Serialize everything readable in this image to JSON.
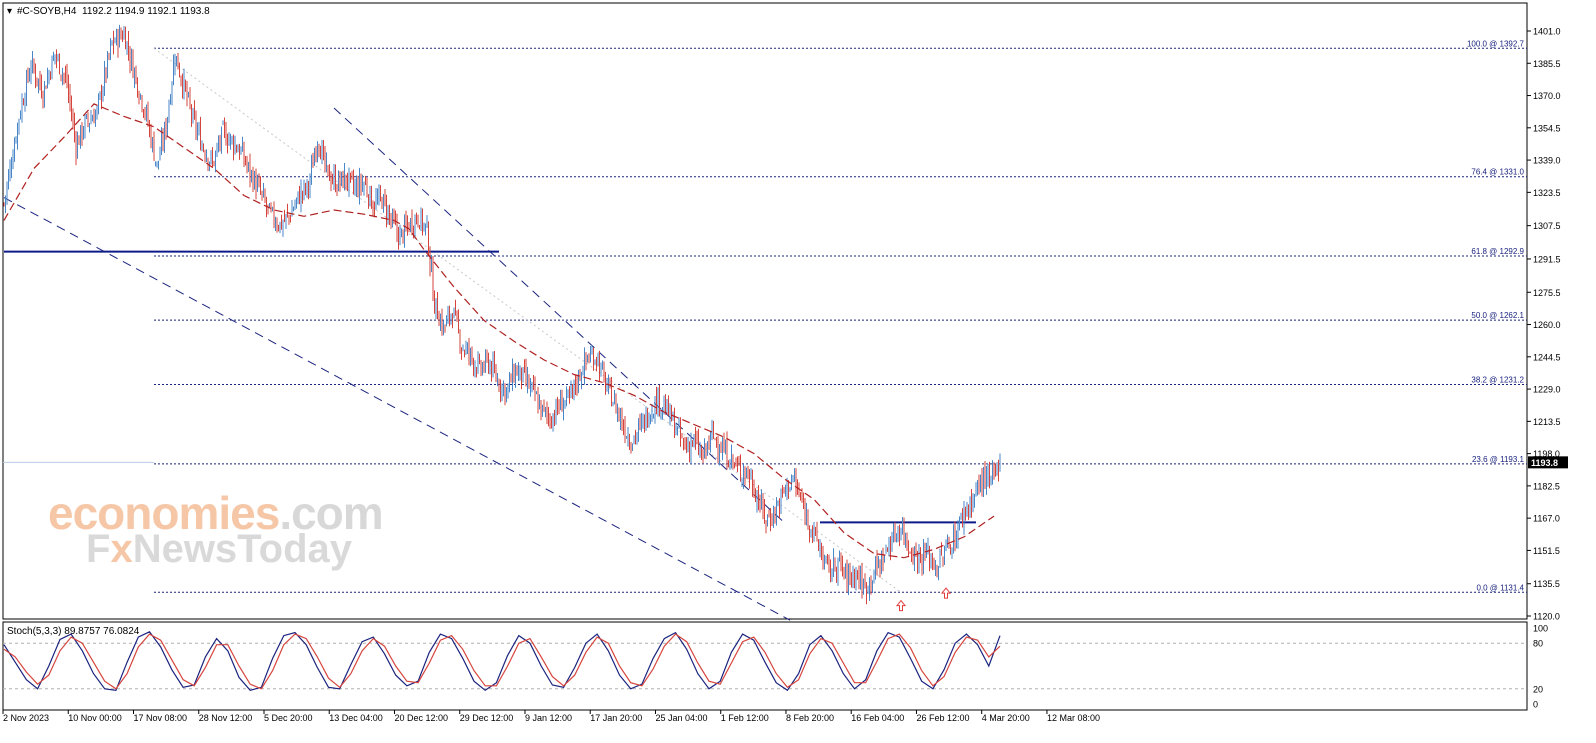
{
  "header": {
    "symbol": "#C-SOYB,H4",
    "ohlc": "1192.2 1194.9 1192.1 1193.8"
  },
  "current_price_label": "1193.8",
  "watermark": {
    "line1_part1": "economies",
    "line1_part2": ".com",
    "line2_part1": "F",
    "line2_x": "x",
    "line2_part2": "NewsToday"
  },
  "colors": {
    "bull_candle": "#4a87c8",
    "bear_candle": "#d6453d",
    "moving_average": "#b02020",
    "fib_lines": "#1a237e",
    "channel_lines": "#1a237e",
    "support_line": "#0d1b8a",
    "stoch_main": "#1a237e",
    "stoch_signal": "#d6453d",
    "arrows": "#e23b3b"
  },
  "chart_data": [
    {
      "type": "candlestick",
      "symbol": "#C-SOYB",
      "timeframe": "H4",
      "ylim": [
        1120.0,
        1408.0
      ],
      "y_tick_labels": [
        "1401.0",
        "1385.5",
        "1370.0",
        "1354.5",
        "1339.0",
        "1323.5",
        "1307.5",
        "1291.5",
        "1275.5",
        "1260.0",
        "1244.5",
        "1229.0",
        "1213.5",
        "1198.0",
        "1182.5",
        "1167.0",
        "1151.5",
        "1135.5",
        "1120.0"
      ],
      "x_tick_labels": [
        "2 Nov 2023",
        "10 Nov 00:00",
        "17 Nov 08:00",
        "28 Nov 12:00",
        "5 Dec 20:00",
        "13 Dec 04:00",
        "20 Dec 12:00",
        "29 Dec 12:00",
        "9 Jan 12:00",
        "17 Jan 20:00",
        "25 Jan 04:00",
        "1 Feb 12:00",
        "8 Feb 20:00",
        "16 Feb 04:00",
        "26 Feb 12:00",
        "4 Mar 20:00",
        "12 Mar 08:00"
      ],
      "close_path": [
        [
          0,
          1318
        ],
        [
          10,
          1360
        ],
        [
          18,
          1385
        ],
        [
          26,
          1372
        ],
        [
          34,
          1390
        ],
        [
          42,
          1376
        ],
        [
          48,
          1346
        ],
        [
          54,
          1356
        ],
        [
          62,
          1362
        ],
        [
          72,
          1395
        ],
        [
          80,
          1400
        ],
        [
          88,
          1378
        ],
        [
          95,
          1360
        ],
        [
          102,
          1336
        ],
        [
          108,
          1355
        ],
        [
          114,
          1390
        ],
        [
          120,
          1374
        ],
        [
          126,
          1358
        ],
        [
          133,
          1345
        ],
        [
          139,
          1337
        ],
        [
          146,
          1352
        ],
        [
          152,
          1348
        ],
        [
          158,
          1343
        ],
        [
          164,
          1333
        ],
        [
          171,
          1323
        ],
        [
          177,
          1313
        ],
        [
          184,
          1308
        ],
        [
          190,
          1312
        ],
        [
          197,
          1322
        ],
        [
          203,
          1326
        ],
        [
          209,
          1350
        ],
        [
          215,
          1333
        ],
        [
          222,
          1328
        ],
        [
          228,
          1330
        ],
        [
          234,
          1325
        ],
        [
          240,
          1328
        ],
        [
          246,
          1318
        ],
        [
          252,
          1320
        ],
        [
          258,
          1310
        ],
        [
          264,
          1302
        ],
        [
          270,
          1308
        ],
        [
          276,
          1312
        ],
        [
          282,
          1305
        ],
        [
          287,
          1270
        ],
        [
          293,
          1258
        ],
        [
          299,
          1267
        ],
        [
          305,
          1250
        ],
        [
          311,
          1245
        ],
        [
          317,
          1238
        ],
        [
          323,
          1242
        ],
        [
          329,
          1233
        ],
        [
          335,
          1228
        ],
        [
          341,
          1238
        ],
        [
          347,
          1234
        ],
        [
          353,
          1227
        ],
        [
          359,
          1218
        ],
        [
          365,
          1215
        ],
        [
          371,
          1222
        ],
        [
          377,
          1224
        ],
        [
          383,
          1235
        ],
        [
          389,
          1244
        ],
        [
          395,
          1245
        ],
        [
          400,
          1233
        ],
        [
          406,
          1224
        ],
        [
          412,
          1213
        ],
        [
          418,
          1204
        ],
        [
          424,
          1210
        ],
        [
          430,
          1218
        ],
        [
          436,
          1224
        ],
        [
          442,
          1219
        ],
        [
          448,
          1210
        ],
        [
          454,
          1201
        ],
        [
          460,
          1204
        ],
        [
          466,
          1196
        ],
        [
          472,
          1207
        ],
        [
          478,
          1201
        ],
        [
          484,
          1196
        ],
        [
          490,
          1190
        ],
        [
          496,
          1189
        ],
        [
          502,
          1178
        ],
        [
          508,
          1166
        ],
        [
          514,
          1170
        ],
        [
          520,
          1180
        ],
        [
          526,
          1186
        ],
        [
          532,
          1174
        ],
        [
          538,
          1163
        ],
        [
          544,
          1152
        ],
        [
          550,
          1141
        ],
        [
          556,
          1146
        ],
        [
          562,
          1138
        ],
        [
          568,
          1141
        ],
        [
          574,
          1133
        ],
        [
          580,
          1141
        ],
        [
          586,
          1148
        ],
        [
          592,
          1157
        ],
        [
          598,
          1163
        ],
        [
          604,
          1152
        ],
        [
          610,
          1148
        ],
        [
          616,
          1150
        ],
        [
          622,
          1143
        ],
        [
          628,
          1152
        ],
        [
          634,
          1158
        ],
        [
          640,
          1170
        ],
        [
          646,
          1176
        ],
        [
          652,
          1186
        ],
        [
          658,
          1184
        ],
        [
          664,
          1193.8
        ]
      ],
      "moving_average": [
        [
          0,
          1310
        ],
        [
          20,
          1335
        ],
        [
          40,
          1350
        ],
        [
          60,
          1366
        ],
        [
          80,
          1360
        ],
        [
          100,
          1355
        ],
        [
          120,
          1345
        ],
        [
          140,
          1335
        ],
        [
          160,
          1322
        ],
        [
          180,
          1315
        ],
        [
          200,
          1312
        ],
        [
          220,
          1315
        ],
        [
          240,
          1313
        ],
        [
          260,
          1310
        ],
        [
          270,
          1306
        ],
        [
          280,
          1296
        ],
        [
          300,
          1278
        ],
        [
          320,
          1262
        ],
        [
          340,
          1252
        ],
        [
          360,
          1243
        ],
        [
          380,
          1236
        ],
        [
          400,
          1232
        ],
        [
          420,
          1226
        ],
        [
          440,
          1218
        ],
        [
          460,
          1212
        ],
        [
          480,
          1206
        ],
        [
          500,
          1198
        ],
        [
          520,
          1186
        ],
        [
          540,
          1176
        ],
        [
          560,
          1160
        ],
        [
          580,
          1150
        ],
        [
          600,
          1148
        ],
        [
          620,
          1152
        ],
        [
          640,
          1158
        ],
        [
          660,
          1168
        ]
      ],
      "fibonacci_levels": [
        {
          "label": "100.0 @ 1392.7",
          "value": 1392.7
        },
        {
          "label": "76.4 @ 1331.0",
          "value": 1331.0
        },
        {
          "label": "61.8 @ 1292.9",
          "value": 1292.9
        },
        {
          "label": "50.0 @ 1262.1",
          "value": 1262.1
        },
        {
          "label": "38.2 @ 1231.2",
          "value": 1231.2
        },
        {
          "label": "23.6 @ 1193.1",
          "value": 1193.1
        },
        {
          "label": "0.0 @ 1131.4",
          "value": 1131.4
        }
      ],
      "fib_start_bar": 100,
      "support_resistance": [
        {
          "from_bar": 0,
          "to_bar": 330,
          "value": 1295
        },
        {
          "from_bar": 544,
          "to_bar": 648,
          "value": 1165
        }
      ],
      "channel": {
        "upper": [
          [
            220,
            1364
          ],
          [
            520,
            1165
          ]
        ],
        "lower": [
          [
            0,
            1321
          ],
          [
            524,
            1118
          ]
        ]
      },
      "arrows": [
        {
          "bar": 598,
          "value": 1125
        },
        {
          "bar": 628,
          "value": 1131
        }
      ]
    },
    {
      "type": "line",
      "indicator": "Stoch(5,3,3)",
      "header_label": "Stoch(5,3,3) 89.8757 76.0824",
      "ylim": [
        0,
        100
      ],
      "y_tick_labels": [
        "100",
        "80",
        "20",
        "0"
      ],
      "levels": [
        80,
        20
      ],
      "series": [
        {
          "name": "main",
          "values": [
            78,
            55,
            32,
            20,
            50,
            85,
            92,
            70,
            40,
            20,
            18,
            55,
            88,
            95,
            75,
            45,
            22,
            25,
            62,
            86,
            70,
            35,
            18,
            22,
            60,
            90,
            94,
            78,
            48,
            22,
            20,
            52,
            82,
            88,
            66,
            38,
            24,
            30,
            68,
            92,
            86,
            60,
            30,
            18,
            28,
            64,
            90,
            80,
            50,
            25,
            22,
            48,
            80,
            92,
            70,
            38,
            20,
            26,
            60,
            86,
            94,
            72,
            40,
            20,
            30,
            68,
            92,
            84,
            55,
            28,
            18,
            40,
            78,
            90,
            70,
            40,
            20,
            32,
            70,
            94,
            88,
            60,
            30,
            20,
            45,
            80,
            92,
            78,
            50,
            89.9
          ]
        },
        {
          "name": "signal",
          "values": [
            72,
            62,
            42,
            26,
            38,
            70,
            88,
            80,
            55,
            30,
            20,
            40,
            75,
            92,
            84,
            58,
            32,
            24,
            48,
            78,
            78,
            50,
            26,
            20,
            44,
            78,
            92,
            86,
            62,
            34,
            22,
            40,
            70,
            86,
            76,
            50,
            30,
            28,
            54,
            84,
            90,
            72,
            44,
            24,
            24,
            50,
            80,
            86,
            62,
            36,
            24,
            38,
            68,
            88,
            80,
            50,
            28,
            24,
            46,
            76,
            92,
            82,
            54,
            30,
            26,
            54,
            82,
            88,
            68,
            40,
            22,
            32,
            66,
            86,
            80,
            54,
            28,
            28,
            56,
            86,
            92,
            74,
            44,
            24,
            36,
            68,
            88,
            84,
            62,
            76.1
          ]
        }
      ]
    }
  ]
}
